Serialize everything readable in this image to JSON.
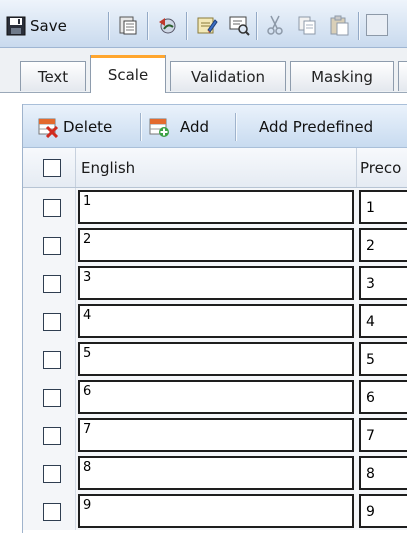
{
  "toolbar": {
    "save_label": "Save",
    "icons": [
      "paste-special-icon",
      "undo-history-icon",
      "edit-notes-icon",
      "preview-icon",
      "cut-icon",
      "copy-icon",
      "paste-icon"
    ]
  },
  "tabs": [
    {
      "label": "Text",
      "active": false
    },
    {
      "label": "Scale",
      "active": true
    },
    {
      "label": "Validation",
      "active": false
    },
    {
      "label": "Masking",
      "active": false
    }
  ],
  "grid_toolbar": {
    "delete_label": "Delete",
    "add_label": "Add",
    "add_predefined_label": "Add Predefined"
  },
  "grid": {
    "columns": [
      "English",
      "Preco"
    ],
    "rows": [
      {
        "english": "1",
        "precode": "1"
      },
      {
        "english": "2",
        "precode": "2"
      },
      {
        "english": "3",
        "precode": "3"
      },
      {
        "english": "4",
        "precode": "4"
      },
      {
        "english": "5",
        "precode": "5"
      },
      {
        "english": "6",
        "precode": "6"
      },
      {
        "english": "7",
        "precode": "7"
      },
      {
        "english": "8",
        "precode": "8"
      },
      {
        "english": "9",
        "precode": "9"
      }
    ]
  },
  "colors": {
    "toolbar_top": "#eef4fb",
    "toolbar_bottom": "#c9daee",
    "active_tab_accent": "#ffa62e",
    "row_background": "#f4f6f9"
  }
}
